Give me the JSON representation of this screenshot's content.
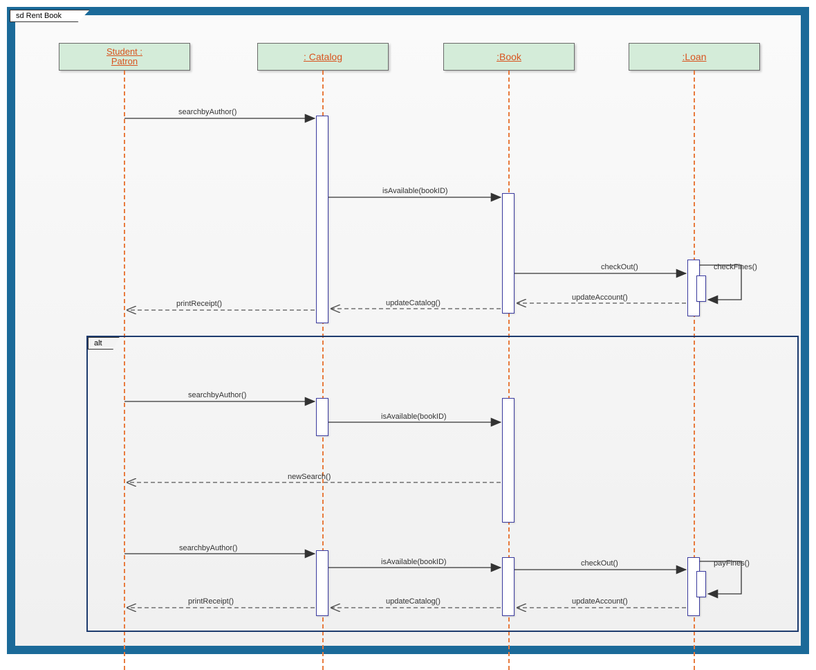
{
  "frame": {
    "title": "sd Rent Book"
  },
  "participants": {
    "student": "Student :\nPatron",
    "catalog": ": Catalog",
    "book": ":Book",
    "loan": ":Loan"
  },
  "messages": {
    "m1": "searchbyAuthor()",
    "m2": "isAvailable(bookID)",
    "m3": "checkOut()",
    "m4": "checkFines()",
    "m5": "updateAccount()",
    "m6": "updateCatalog()",
    "m7": "printReceipt()",
    "m8": "searchbyAuthor()",
    "m9": "isAvailable(bookID)",
    "m10": "newSearch()",
    "m11": "searchbyAuthor()",
    "m12": "isAvailable(bookID)",
    "m13": "checkOut()",
    "m14": "payFines()",
    "m15": "updateAccount()",
    "m16": "updateCatalog()",
    "m17": "printReceipt()"
  },
  "altLabel": "alt"
}
